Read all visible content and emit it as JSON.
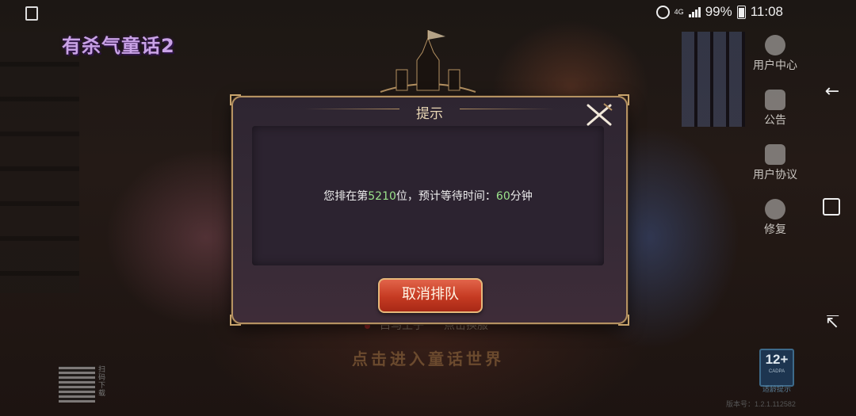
{
  "status_bar": {
    "network": "4G",
    "battery": "99%",
    "time": "11:08"
  },
  "game_logo": "有杀气童话2",
  "side_menu": [
    {
      "label": "用户中心",
      "icon": "user-icon"
    },
    {
      "label": "公告",
      "icon": "megaphone-icon"
    },
    {
      "label": "用户协议",
      "icon": "id-card-icon"
    },
    {
      "label": "修复",
      "icon": "repair-icon"
    }
  ],
  "dialog": {
    "title": "提示",
    "message_prefix": "您排在第",
    "rank": "5210",
    "message_mid": "位，预计等待时间：",
    "wait_minutes": "60",
    "message_suffix": "分钟",
    "cancel_label": "取消排队"
  },
  "background": {
    "character_name": "白马王子",
    "switch_label": "点击换服",
    "enter_label": "点击进入童话世界",
    "qr_label": "扫码下载",
    "age_rating": "12+",
    "age_rating_org": "CADPA",
    "age_tip": "适龄提示",
    "version": "版本号：1.2.1.112582"
  },
  "colors": {
    "highlight": "#9be38b",
    "button": "#c53a22",
    "frame_gold": "#b59262"
  }
}
